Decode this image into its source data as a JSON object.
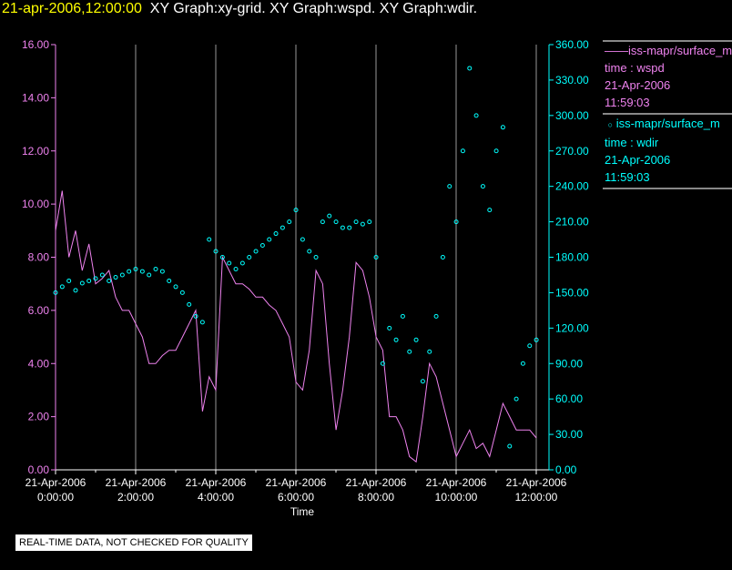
{
  "header": {
    "timestamp": "21-apr-2006,12:00:00",
    "graphs": "XY Graph:xy-grid.  XY Graph:wspd.  XY Graph:wdir."
  },
  "legend": [
    {
      "symbol": "——",
      "name": "iss-mapr/surface_m",
      "var": "time : wspd",
      "date": "21-Apr-2006",
      "time": "11:59:03",
      "color": "#ee82ee"
    },
    {
      "symbol": "○",
      "name": "iss-mapr/surface_m",
      "var": "time : wdir",
      "date": "21-Apr-2006",
      "time": "11:59:03",
      "color": "#00ffff"
    }
  ],
  "note": "REAL-TIME DATA, NOT CHECKED FOR QUALITY",
  "chart_data": {
    "type": "line",
    "xlabel": "Time",
    "xlim": [
      0,
      12.3
    ],
    "x_ticks": [
      {
        "v": 0,
        "l1": "21-Apr-2006",
        "l2": "0:00:00"
      },
      {
        "v": 2,
        "l1": "21-Apr-2006",
        "l2": "2:00:00"
      },
      {
        "v": 4,
        "l1": "21-Apr-2006",
        "l2": "4:00:00"
      },
      {
        "v": 6,
        "l1": "21-Apr-2006",
        "l2": "6:00:00"
      },
      {
        "v": 8,
        "l1": "21-Apr-2006",
        "l2": "8:00:00"
      },
      {
        "v": 10,
        "l1": "21-Apr-2006",
        "l2": "10:00:00"
      },
      {
        "v": 12,
        "l1": "21-Apr-2006",
        "l2": "12:00:00"
      }
    ],
    "left_axis": {
      "ylim": [
        0,
        16
      ],
      "ticks": [
        "0.00",
        "2.00",
        "4.00",
        "6.00",
        "8.00",
        "10.00",
        "12.00",
        "14.00",
        "16.00"
      ],
      "color": "#ee82ee"
    },
    "right_axis": {
      "ylim": [
        0,
        360
      ],
      "ticks": [
        "0.00",
        "30.00",
        "60.00",
        "90.00",
        "120.00",
        "150.00",
        "180.00",
        "210.00",
        "240.00",
        "270.00",
        "300.00",
        "330.00",
        "360.00"
      ],
      "color": "#00ffff"
    },
    "series": [
      {
        "name": "wspd",
        "axis": "left",
        "style": "line",
        "color": "#ee82ee",
        "step_hours": 0.1667,
        "values": [
          9,
          10.5,
          8,
          9,
          7.5,
          8.5,
          7,
          7.2,
          7.5,
          6.5,
          6,
          6,
          5.5,
          5,
          4,
          4,
          4.3,
          4.5,
          4.5,
          5,
          5.5,
          6,
          2.2,
          3.5,
          3,
          8,
          7.5,
          7,
          7,
          6.8,
          6.5,
          6.5,
          6.2,
          6,
          5.5,
          5,
          3.3,
          3,
          4.5,
          7.5,
          7,
          4,
          1.5,
          3,
          5,
          7.8,
          7.5,
          6.5,
          5,
          4.5,
          2,
          2,
          1.5,
          0.5,
          0.3,
          2,
          4,
          3.5,
          2.5,
          1.5,
          0.5,
          1,
          1.5,
          0.8,
          1,
          0.5,
          1.5,
          2.5,
          2,
          1.5,
          1.5,
          1.5,
          1.2
        ]
      },
      {
        "name": "wdir",
        "axis": "right",
        "style": "scatter",
        "color": "#00ffff",
        "step_hours": 0.1667,
        "values": [
          150,
          155,
          160,
          152,
          158,
          160,
          162,
          165,
          160,
          163,
          165,
          168,
          170,
          168,
          165,
          170,
          168,
          160,
          155,
          150,
          140,
          130,
          125,
          195,
          185,
          180,
          175,
          170,
          175,
          180,
          185,
          190,
          195,
          200,
          205,
          210,
          220,
          195,
          185,
          180,
          210,
          215,
          210,
          205,
          205,
          210,
          208,
          210,
          180,
          90,
          120,
          110,
          130,
          100,
          110,
          75,
          100,
          130,
          180,
          240,
          210,
          270,
          340,
          300,
          240,
          220,
          270,
          290,
          20,
          60,
          90,
          105,
          110
        ]
      }
    ]
  }
}
